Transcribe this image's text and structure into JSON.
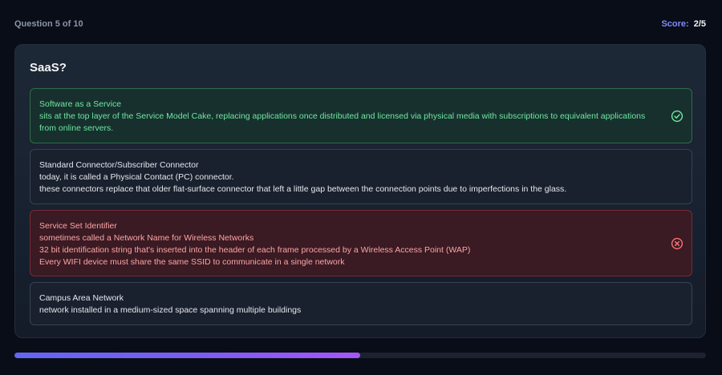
{
  "header": {
    "question_counter": "Question 5 of 10",
    "score_label": "Score:",
    "score_value": "2/5"
  },
  "question": {
    "text": "SaaS?"
  },
  "options": [
    {
      "state": "correct",
      "status_icon": "check-circle-icon",
      "lines": [
        "Software as a Service",
        "sits at the top layer of the Service Model Cake, replacing applications once distributed and licensed via physical media with subscriptions to equivalent applications from online servers."
      ]
    },
    {
      "state": "neutral",
      "lines": [
        "Standard Connector/Subscriber Connector",
        "today, it is called a Physical Contact (PC) connector.",
        "these connectors replace that older flat-surface connector that left a little gap between the connection points due to imperfections in the glass."
      ]
    },
    {
      "state": "wrong",
      "status_icon": "x-circle-icon",
      "lines": [
        "Service Set Identifier",
        "sometimes called a Network Name for Wireless Networks",
        "32 bit identification string that's inserted into the header of each frame processed by a Wireless Access Point (WAP)",
        "Every WIFI device must share the same SSID to communicate in a single network"
      ]
    },
    {
      "state": "neutral",
      "lines": [
        "Campus Area Network",
        "network installed in a medium-sized space spanning multiple buildings"
      ]
    }
  ],
  "progress": {
    "fraction": 0.5
  },
  "colors": {
    "correct": "#6ee7a0",
    "wrong": "#f87171",
    "accent": "#818cf8"
  }
}
